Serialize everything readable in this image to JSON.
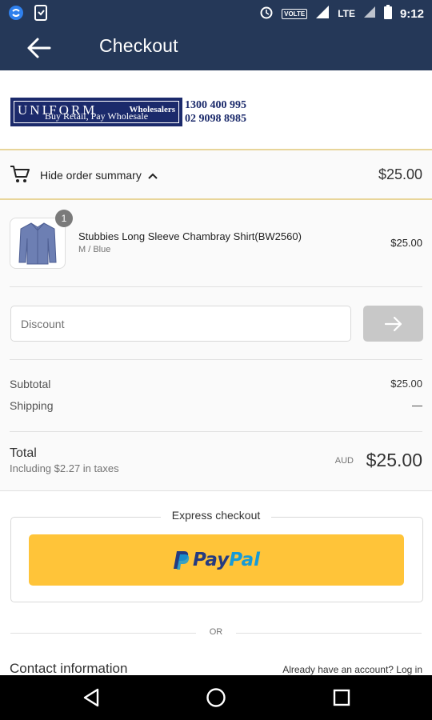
{
  "status_bar": {
    "time": "9:12",
    "network": "LTE",
    "volte": "VOLTE"
  },
  "app_bar": {
    "title": "Checkout"
  },
  "logo": {
    "brand": "UNIFORM",
    "brand_suffix": "Wholesalers",
    "tagline": "Buy Retail, Pay Wholesale",
    "phone_1": "1300 400 995",
    "phone_2": "02 9098 8985"
  },
  "summary_toggle": {
    "label": "Hide order summary",
    "total": "$25.00"
  },
  "product": {
    "name": "Stubbies Long Sleeve Chambray Shirt(BW2560)",
    "variant": "M / Blue",
    "price": "$25.00",
    "quantity": "1"
  },
  "discount": {
    "placeholder": "Discount"
  },
  "lines": {
    "subtotal_label": "Subtotal",
    "subtotal_value": "$25.00",
    "shipping_label": "Shipping",
    "shipping_value": "—"
  },
  "total": {
    "label": "Total",
    "taxes": "Including $2.27 in taxes",
    "currency": "AUD",
    "amount": "$25.00"
  },
  "express": {
    "title": "Express checkout",
    "paypal_pay": "Pay",
    "paypal_pal": "Pal"
  },
  "or_text": "OR",
  "contact": {
    "title": "Contact information",
    "login": "Already have an account? Log in"
  },
  "colors": {
    "header": "#253858",
    "paypal": "#ffc439",
    "divider_gold": "#e8d59a"
  }
}
